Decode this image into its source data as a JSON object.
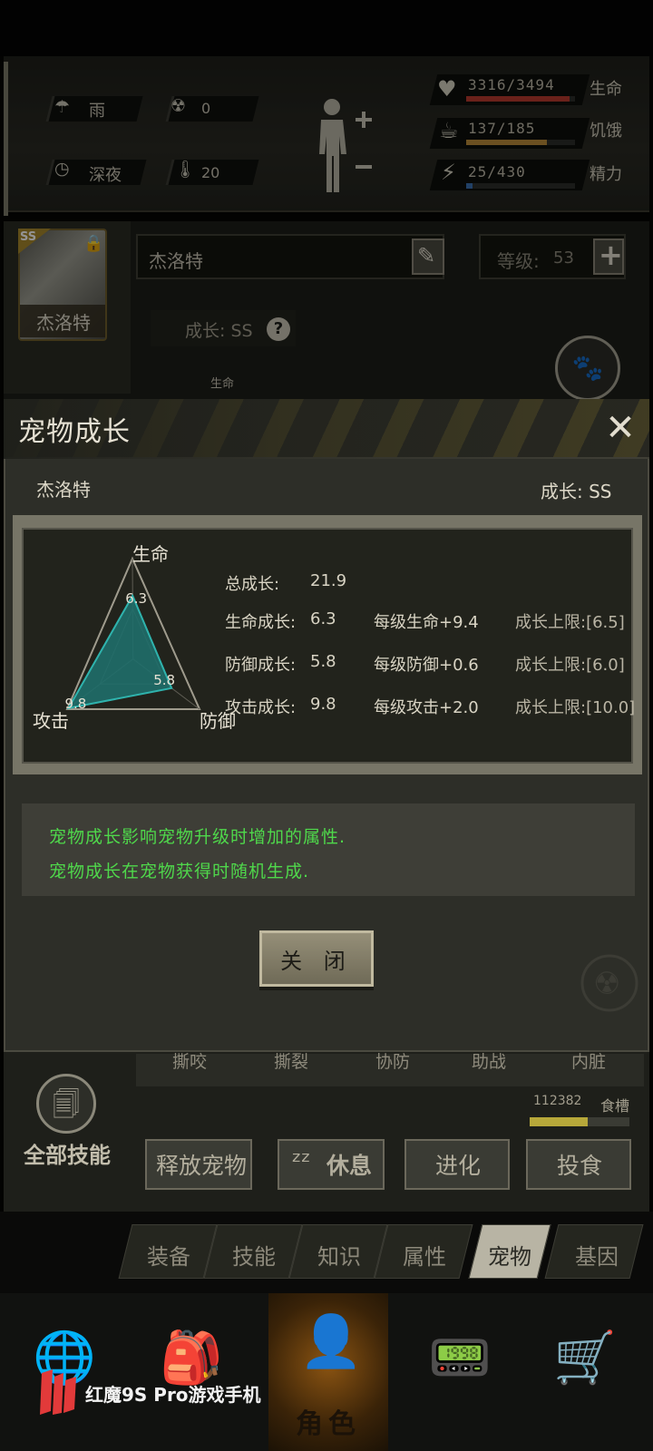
{
  "status": {
    "weather": "雨",
    "radiation": "0",
    "time_of_day": "深夜",
    "temperature": "20",
    "stats": [
      {
        "value": "3316/3494",
        "label": "生命",
        "fraction": 0.949,
        "color": "#b73a2e"
      },
      {
        "value": "137/185",
        "label": "饥饿",
        "fraction": 0.741,
        "color": "#b88a3a"
      },
      {
        "value": "25/430",
        "label": "精力",
        "fraction": 0.058,
        "color": "#3a6fb0"
      }
    ]
  },
  "pet": {
    "rank_badge": "SS",
    "card_name": "杰洛特",
    "name": "杰洛特",
    "level_label": "等级:",
    "level": "53",
    "growth_chip": "成长: SS",
    "mini_label": "生命"
  },
  "modal": {
    "title": "宠物成长",
    "pet_name": "杰洛特",
    "growth_rank": "成长: SS",
    "radar": {
      "axes": [
        "生命",
        "防御",
        "攻击"
      ],
      "values": [
        6.3,
        5.8,
        9.8
      ],
      "value_labels": [
        "6.3",
        "5.8",
        "9.8"
      ],
      "max": 10
    },
    "total": {
      "label": "总成长:",
      "value": "21.9"
    },
    "rows": [
      {
        "label": "生命成长:",
        "value": "6.3",
        "per_level": "每级生命+9.4",
        "cap": "成长上限:[6.5]"
      },
      {
        "label": "防御成长:",
        "value": "5.8",
        "per_level": "每级防御+0.6",
        "cap": "成长上限:[6.0]"
      },
      {
        "label": "攻击成长:",
        "value": "9.8",
        "per_level": "每级攻击+2.0",
        "cap": "成长上限:[10.0]"
      }
    ],
    "tips": [
      "宠物成长影响宠物升级时增加的属性.",
      "宠物成长在宠物获得时随机生成."
    ],
    "close_label": "关 闭"
  },
  "lower": {
    "skill_tabs": [
      "撕咬",
      "撕裂",
      "协防",
      "助战",
      "内脏"
    ],
    "food_value": "112382",
    "food_label": "食槽",
    "food_fraction": 0.58,
    "all_skills": "全部技能",
    "actions": [
      "释放宠物",
      "休息",
      "进化",
      "投食"
    ]
  },
  "tabs": [
    {
      "label": "装备"
    },
    {
      "label": "技能"
    },
    {
      "label": "知识"
    },
    {
      "label": "属性"
    },
    {
      "label": "宠物"
    },
    {
      "label": "基因"
    }
  ],
  "nav": {
    "active_label": "角色"
  },
  "watermark": "红魔9S Pro游戏手机"
}
